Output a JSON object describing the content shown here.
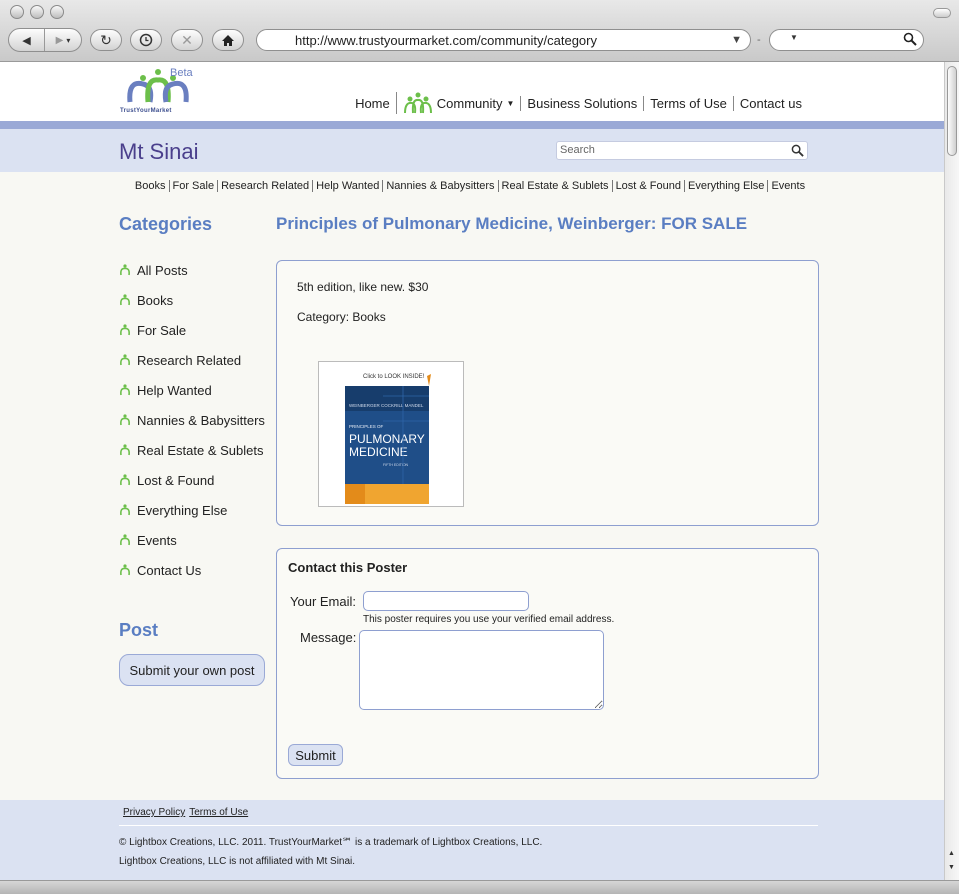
{
  "browser": {
    "url": "http://www.trustyourmarket.com/community/category",
    "search_placeholder": ""
  },
  "header": {
    "logo_beta": "Beta",
    "logo_name": "TrustYourMarket",
    "nav": {
      "home": "Home",
      "community": "Community",
      "business": "Business Solutions",
      "terms": "Terms of Use",
      "contact": "Contact us"
    },
    "site_name": "Mt Sinai",
    "search_placeholder": "Search"
  },
  "catnav": [
    "Books",
    "For Sale",
    "Research Related",
    "Help Wanted",
    "Nannies & Babysitters",
    "Real Estate & Sublets",
    "Lost & Found",
    "Everything Else",
    "Events"
  ],
  "sidebar": {
    "categories_title": "Categories",
    "items": [
      "All Posts",
      "Books",
      "For Sale",
      "Research Related",
      "Help Wanted",
      "Nannies & Babysitters",
      "Real Estate & Sublets",
      "Lost & Found",
      "Everything Else",
      "Events",
      "Contact Us"
    ],
    "post_title": "Post",
    "post_button": "Submit your own post"
  },
  "listing": {
    "title": "Principles of Pulmonary Medicine, Weinberger: FOR SALE",
    "description": "5th edition, like new. $30",
    "category": "Category: Books",
    "book": {
      "look_inside": "Click to LOOK INSIDE!",
      "authors": "WEINBERGER  COCKRILL  MANDEL",
      "series_line": "PRINCIPLES OF",
      "title_line1": "PULMONARY",
      "title_line2": "MEDICINE",
      "edition": "FIFTH EDITION"
    }
  },
  "contact": {
    "title": "Contact this Poster",
    "email_label": "Your Email:",
    "email_value": "",
    "email_note": "This poster requires you use your verified email address.",
    "message_label": "Message:",
    "message_value": "",
    "submit": "Submit"
  },
  "footer": {
    "privacy": "Privacy Policy",
    "terms": "Terms of Use",
    "copyright": "© Lightbox Creations, LLC. 2011. TrustYourMarket℠ is a trademark of Lightbox Creations, LLC.",
    "disclaimer": "Lightbox Creations, LLC is not affiliated with Mt Sinai."
  },
  "colors": {
    "accent": "#5a7ec2",
    "band": "#dbe2f2",
    "stripe": "#9aa9d6",
    "site_name": "#4a3f8c",
    "logo_green": "#6cbf4a"
  }
}
